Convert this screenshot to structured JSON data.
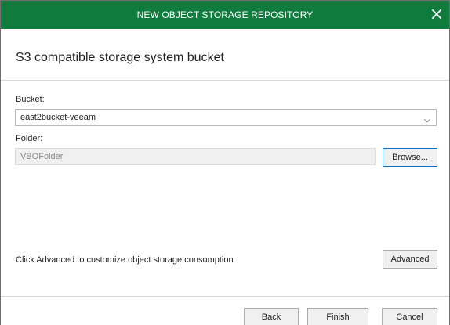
{
  "window": {
    "title": "NEW OBJECT STORAGE REPOSITORY",
    "close_icon": "close-icon",
    "accent_color": "#0f7b3d"
  },
  "header": {
    "title": "S3 compatible storage system bucket"
  },
  "bucket": {
    "label": "Bucket:",
    "selected_value": "east2bucket-veeam",
    "dropdown_icon": "chevron-down-icon"
  },
  "folder": {
    "label": "Folder:",
    "value": "VBOFolder",
    "browse_label": "Browse..."
  },
  "advanced": {
    "description": "Click Advanced to customize object storage consumption",
    "button_label": "Advanced"
  },
  "footer": {
    "back_label": "Back",
    "finish_label": "Finish",
    "cancel_label": "Cancel"
  }
}
